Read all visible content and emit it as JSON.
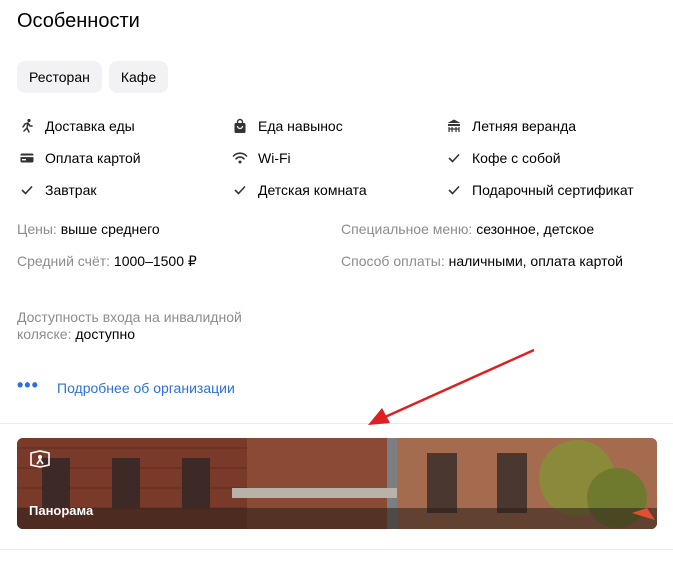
{
  "section": {
    "title": "Особенности",
    "chips": [
      "Ресторан",
      "Кафе"
    ]
  },
  "features": [
    [
      {
        "icon": "running-person-icon",
        "label": "Доставка еды"
      },
      {
        "icon": "shopping-bag-icon",
        "label": "Еда навынос"
      },
      {
        "icon": "veranda-icon",
        "label": "Летняя веранда"
      }
    ],
    [
      {
        "icon": "credit-card-icon",
        "label": "Оплата картой"
      },
      {
        "icon": "wifi-icon",
        "label": "Wi-Fi"
      },
      {
        "icon": "check-icon",
        "label": "Кофе с собой"
      }
    ],
    [
      {
        "icon": "check-icon",
        "label": "Завтрак"
      },
      {
        "icon": "check-icon",
        "label": "Детская комната"
      },
      {
        "icon": "check-icon",
        "label": "Подарочный сертификат"
      }
    ]
  ],
  "info": {
    "prices": {
      "label": "Цены:",
      "value": "выше среднего"
    },
    "special_menu": {
      "label": "Специальное меню:",
      "value": "сезонное, детское"
    },
    "avg_check": {
      "label": "Средний счёт:",
      "value": "1000–1500 ₽"
    },
    "payment": {
      "label": "Способ оплаты:",
      "value": "наличными, оплата картой"
    },
    "wheelchair": {
      "label": "Доступность входа на инвалидной коляске:",
      "value": "доступно"
    }
  },
  "more": {
    "dots": "•••",
    "link": "Подробнее об организации"
  },
  "panorama": {
    "label": "Панорама"
  },
  "colors": {
    "link": "#2f6fdb",
    "arrow": "#e02020",
    "muted": "#8c8c8c"
  }
}
